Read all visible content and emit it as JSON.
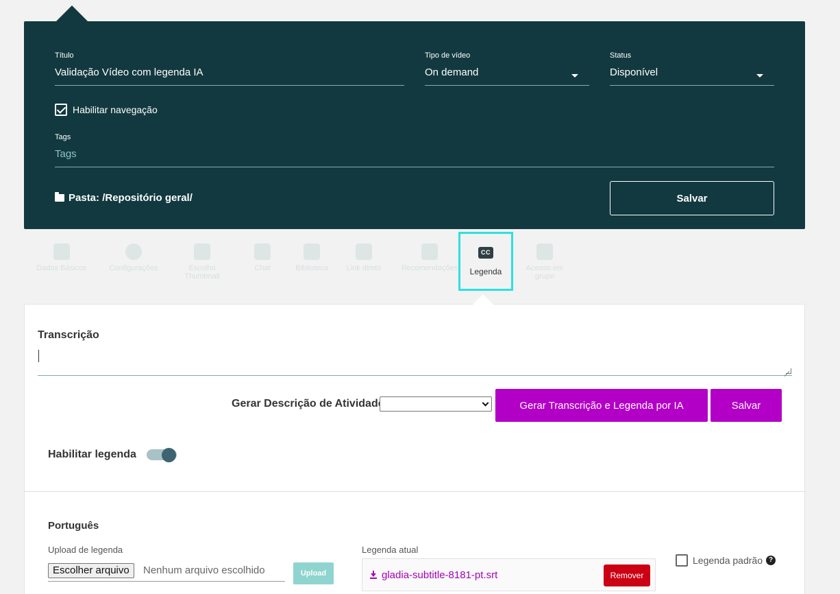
{
  "header": {
    "titulo_label": "Título",
    "titulo_value": "Validação Vídeo com legenda IA",
    "tipo_label": "Tipo de vídeo",
    "tipo_value": "On demand",
    "status_label": "Status",
    "status_value": "Disponível",
    "navegacao_label": "Habilitar navegação",
    "navegacao_checked": true,
    "tags_label": "Tags",
    "tags_placeholder": "Tags",
    "pasta": "Pasta: /Repositório geral/",
    "salvar": "Salvar",
    "bg_color": "#12393f"
  },
  "tabs": [
    {
      "label": "Dados Básicos",
      "icon": "form-icon"
    },
    {
      "label": "Configurações",
      "icon": "cloud-icon"
    },
    {
      "label": "Escolha Thumbnail",
      "icon": "image-icon"
    },
    {
      "label": "Chat",
      "icon": "chat-icon"
    },
    {
      "label": "Biblioteca",
      "icon": "book-icon"
    },
    {
      "label": "Link direto",
      "icon": "qr-icon"
    },
    {
      "label": "Recomendações",
      "icon": "link-icon"
    },
    {
      "label": "Legenda",
      "icon": "cc-icon",
      "active": true
    },
    {
      "label": "Acesso em grupo",
      "icon": "group-icon"
    }
  ],
  "content": {
    "transcricao_title": "Transcrição",
    "transcricao_value": "",
    "gerar_label": "Gerar Descrição de Atividade:",
    "gerar_select_value": "",
    "btn_ia": "Gerar Transcrição e Legenda por IA",
    "btn_salvar": "Salvar",
    "habilitar_legenda": "Habilitar legenda",
    "legenda_enabled": true,
    "accent_color": "#b300c6"
  },
  "language_section": {
    "title": "Português",
    "upload_label": "Upload de legenda",
    "file_button": "Escolher arquivo",
    "file_none": "Nenhum arquivo escolhido",
    "upload_button": "Upload",
    "legenda_atual_label": "Legenda atual",
    "file_name": "gladia-subtitle-8181-pt.srt",
    "remover": "Remover",
    "legenda_padrao": "Legenda padrão",
    "legenda_padrao_checked": false
  }
}
